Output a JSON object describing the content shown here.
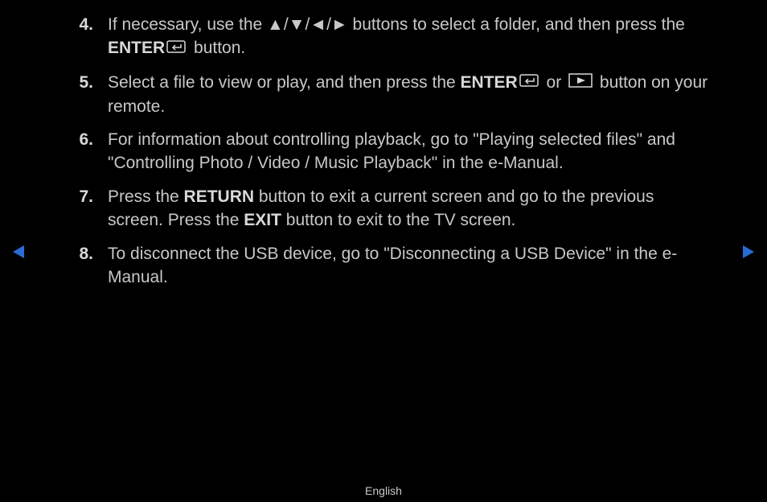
{
  "items": [
    {
      "number": "4.",
      "parts": [
        {
          "type": "text",
          "value": "If necessary, use the "
        },
        {
          "type": "arrows"
        },
        {
          "type": "text",
          "value": " buttons to select a folder, and then press the "
        },
        {
          "type": "bold",
          "value": "ENTER"
        },
        {
          "type": "enter-icon"
        },
        {
          "type": "text",
          "value": " button."
        }
      ]
    },
    {
      "number": "5.",
      "parts": [
        {
          "type": "text",
          "value": "Select a file to view or play, and then press the "
        },
        {
          "type": "bold",
          "value": "ENTER"
        },
        {
          "type": "enter-icon"
        },
        {
          "type": "text",
          "value": " or "
        },
        {
          "type": "play-icon"
        },
        {
          "type": "text",
          "value": " button on your remote."
        }
      ]
    },
    {
      "number": "6.",
      "parts": [
        {
          "type": "text",
          "value": "For information about controlling playback, go to \"Playing selected files\" and \"Controlling Photo / Video / Music Playback\" in the e-Manual."
        }
      ]
    },
    {
      "number": "7.",
      "parts": [
        {
          "type": "text",
          "value": "Press the "
        },
        {
          "type": "bold",
          "value": "RETURN"
        },
        {
          "type": "text",
          "value": " button to exit a current screen and go to the previous screen. Press the "
        },
        {
          "type": "bold",
          "value": "EXIT"
        },
        {
          "type": "text",
          "value": " button to exit to the TV screen."
        }
      ]
    },
    {
      "number": "8.",
      "parts": [
        {
          "type": "text",
          "value": "To disconnect the USB device, go to \"Disconnecting a USB Device\" in the e-Manual."
        }
      ]
    }
  ],
  "footer": "English",
  "arrows_text": "▲/▼/◄/►"
}
